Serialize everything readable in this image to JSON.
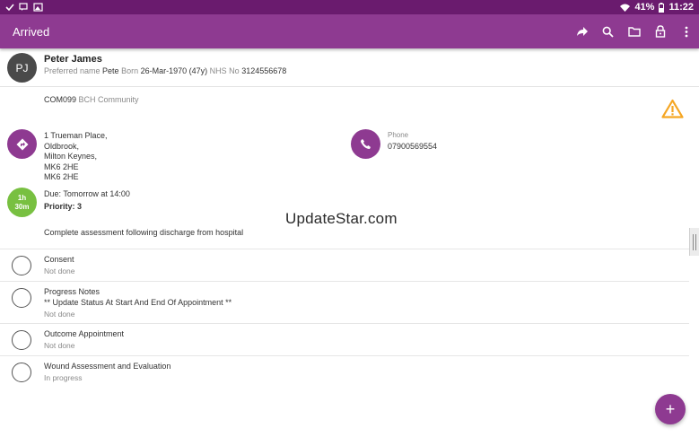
{
  "status_bar": {
    "battery": "41%",
    "time": "11:22"
  },
  "app_bar": {
    "title": "Arrived"
  },
  "patient": {
    "initials": "PJ",
    "name": "Peter James",
    "preferred_label": "Preferred name",
    "preferred_value": "Pete",
    "born_label": "Born",
    "born_value": "26-Mar-1970 (47y)",
    "nhs_label": "NHS No",
    "nhs_value": "3124556678"
  },
  "organisation": {
    "code": "COM099",
    "name": "BCH Community"
  },
  "address": {
    "lines": [
      "1 Trueman Place,",
      "Oldbrook,",
      "Milton Keynes,",
      "MK6 2HE",
      "MK6 2HE"
    ]
  },
  "phone": {
    "label": "Phone",
    "value": "07900569554"
  },
  "appointment": {
    "duration_hours": "1h",
    "duration_minutes": "30m",
    "due": "Due: Tomorrow at 14:00",
    "priority": "Priority: 3",
    "description": "Complete assessment following discharge from hospital"
  },
  "watermark": "UpdateStar.com",
  "tasks": [
    {
      "title": "Consent",
      "subtitle": "",
      "status": "Not done"
    },
    {
      "title": "Progress Notes",
      "subtitle": "**  Update Status At Start And End Of Appointment **",
      "status": "Not done"
    },
    {
      "title": "Outcome Appointment",
      "subtitle": "",
      "status": "Not done"
    },
    {
      "title": "Wound Assessment and Evaluation",
      "subtitle": "",
      "status": "In progress"
    }
  ],
  "fab": {
    "label": "+"
  },
  "colors": {
    "primary": "#8e3a91",
    "status_bar": "#6a1b6e",
    "due_badge": "#78c041",
    "warning": "#f5a623"
  },
  "icons": [
    "share-icon",
    "search-icon",
    "folder-icon",
    "lock-icon",
    "more-vert-icon",
    "warning-icon",
    "directions-icon",
    "phone-icon"
  ]
}
